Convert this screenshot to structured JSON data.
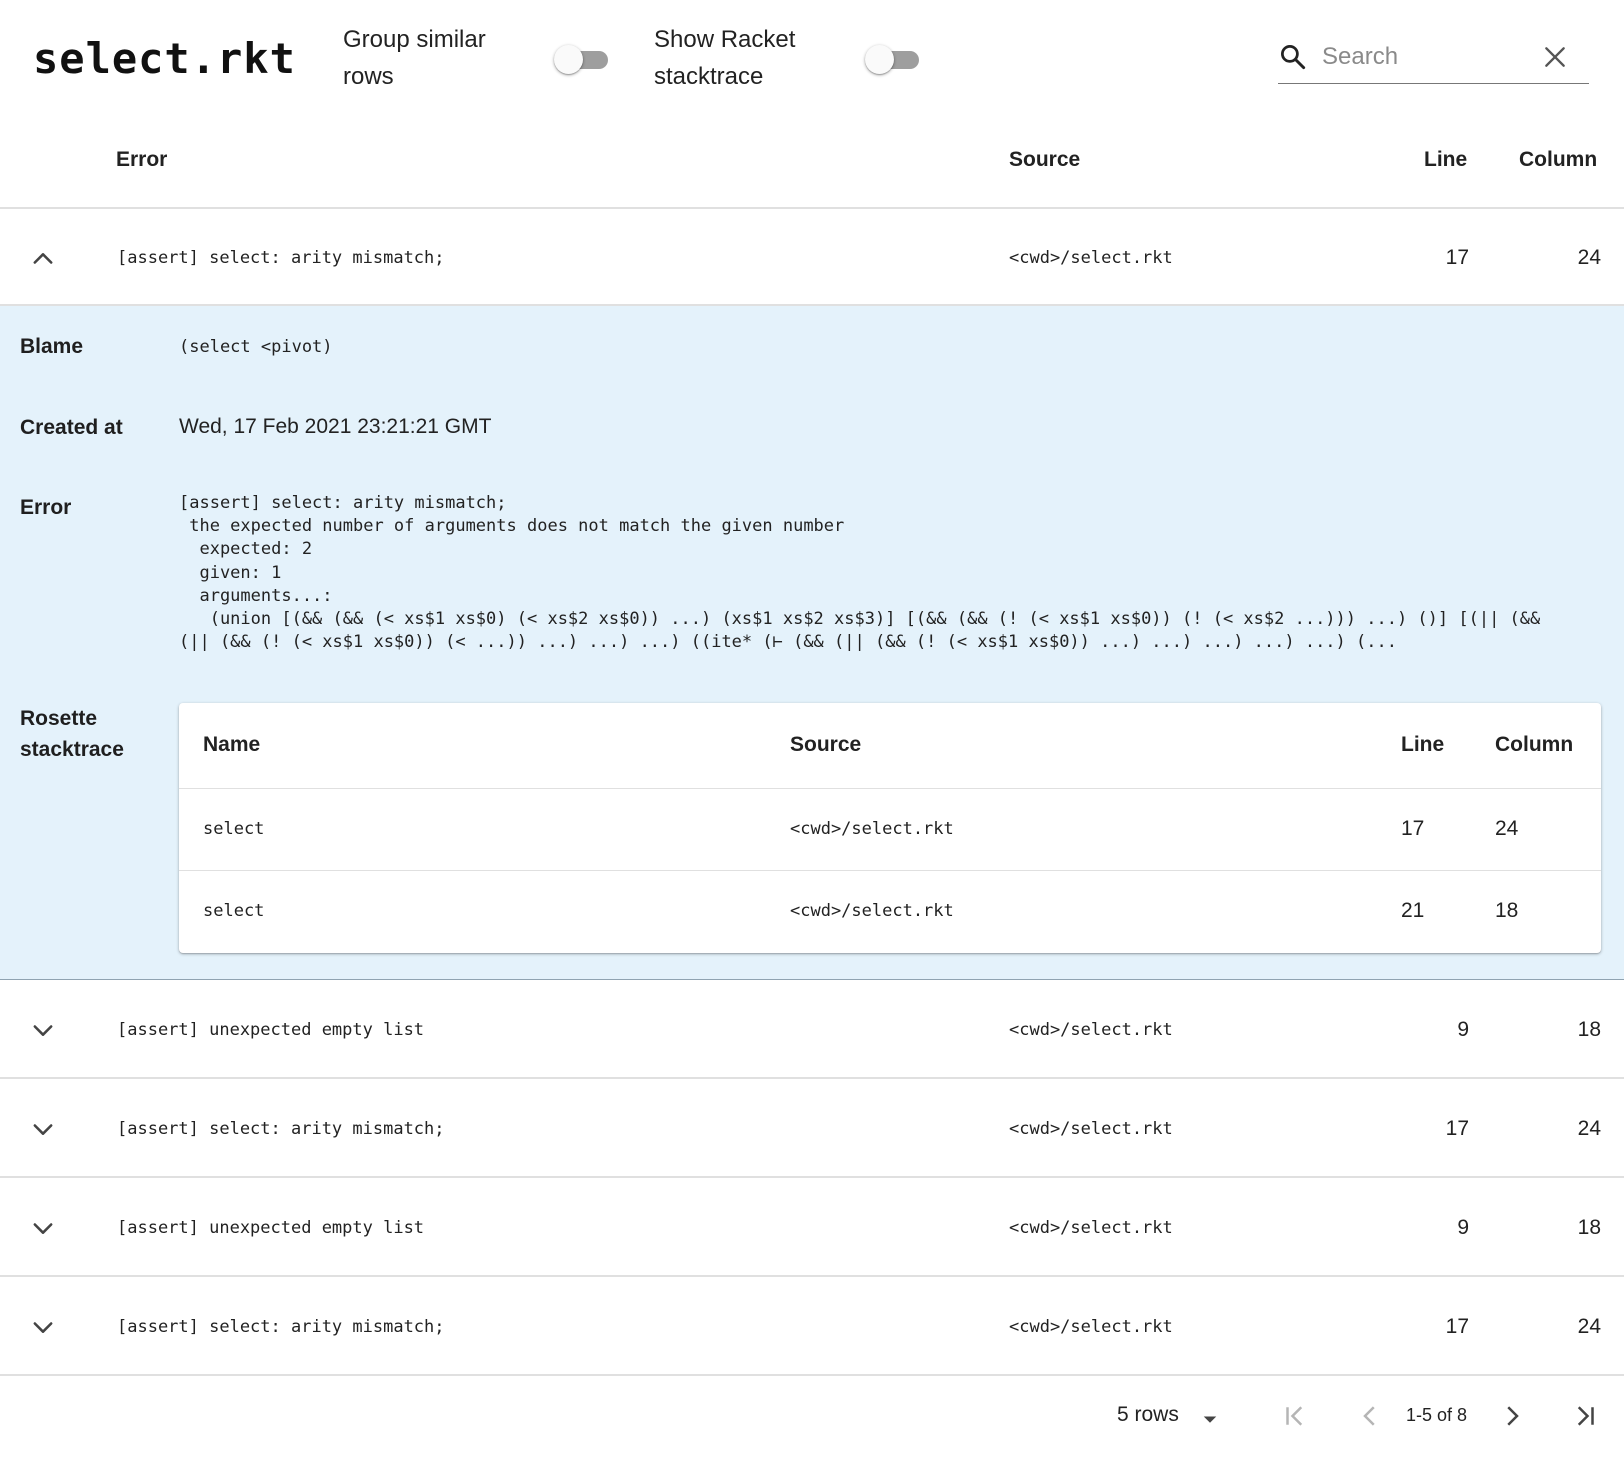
{
  "header": {
    "title": "select.rkt",
    "group_toggle": {
      "label_line1": "Group similar",
      "label_line2": "rows",
      "on": false
    },
    "stacktrace_toggle": {
      "label_line1": "Show Racket",
      "label_line2": "stacktrace",
      "on": false
    },
    "search": {
      "placeholder": "Search",
      "value": "",
      "icon": "search-icon",
      "clear_icon": "close-icon"
    }
  },
  "table": {
    "columns": {
      "error": "Error",
      "source": "Source",
      "line": "Line",
      "column": "Column"
    },
    "rows": [
      {
        "error": "[assert] select: arity mismatch;",
        "source": "<cwd>/select.rkt",
        "line": "17",
        "column": "24",
        "expanded": true
      },
      {
        "error": "[assert] unexpected empty list",
        "source": "<cwd>/select.rkt",
        "line": "9",
        "column": "18",
        "expanded": false
      },
      {
        "error": "[assert] select: arity mismatch;",
        "source": "<cwd>/select.rkt",
        "line": "17",
        "column": "24",
        "expanded": false
      },
      {
        "error": "[assert] unexpected empty list",
        "source": "<cwd>/select.rkt",
        "line": "9",
        "column": "18",
        "expanded": false
      },
      {
        "error": "[assert] select: arity mismatch;",
        "source": "<cwd>/select.rkt",
        "line": "17",
        "column": "24",
        "expanded": false
      }
    ]
  },
  "detail": {
    "blame_label": "Blame",
    "blame_value": "(select <pivot)",
    "created_label": "Created at",
    "created_value": "Wed, 17 Feb 2021 23:21:21 GMT",
    "error_label": "Error",
    "error_text": "[assert] select: arity mismatch;\n the expected number of arguments does not match the given number\n  expected: 2\n  given: 1\n  arguments...:\n   (union [(&& (&& (< xs$1 xs$0) (< xs$2 xs$0)) ...) (xs$1 xs$2 xs$3)] [(&& (&& (! (< xs$1 xs$0)) (! (< xs$2 ...))) ...) ()] [(|| (&&\n(|| (&& (! (< xs$1 xs$0)) (< ...)) ...) ...) ...) ((ite* (⊢ (&& (|| (&& (! (< xs$1 xs$0)) ...) ...) ...) ...) ...) (...",
    "stack_label_line1": "Rosette",
    "stack_label_line2": "stacktrace",
    "stack": {
      "columns": {
        "name": "Name",
        "source": "Source",
        "line": "Line",
        "column": "Column"
      },
      "rows": [
        {
          "name": "select",
          "source": "<cwd>/select.rkt",
          "line": "17",
          "column": "24"
        },
        {
          "name": "select",
          "source": "<cwd>/select.rkt",
          "line": "21",
          "column": "18"
        }
      ]
    }
  },
  "pagination": {
    "rows_per_page": "5 rows",
    "range": "1-5 of 8",
    "icons": [
      "first-page-icon",
      "previous-page-icon",
      "next-page-icon",
      "last-page-icon"
    ]
  }
}
